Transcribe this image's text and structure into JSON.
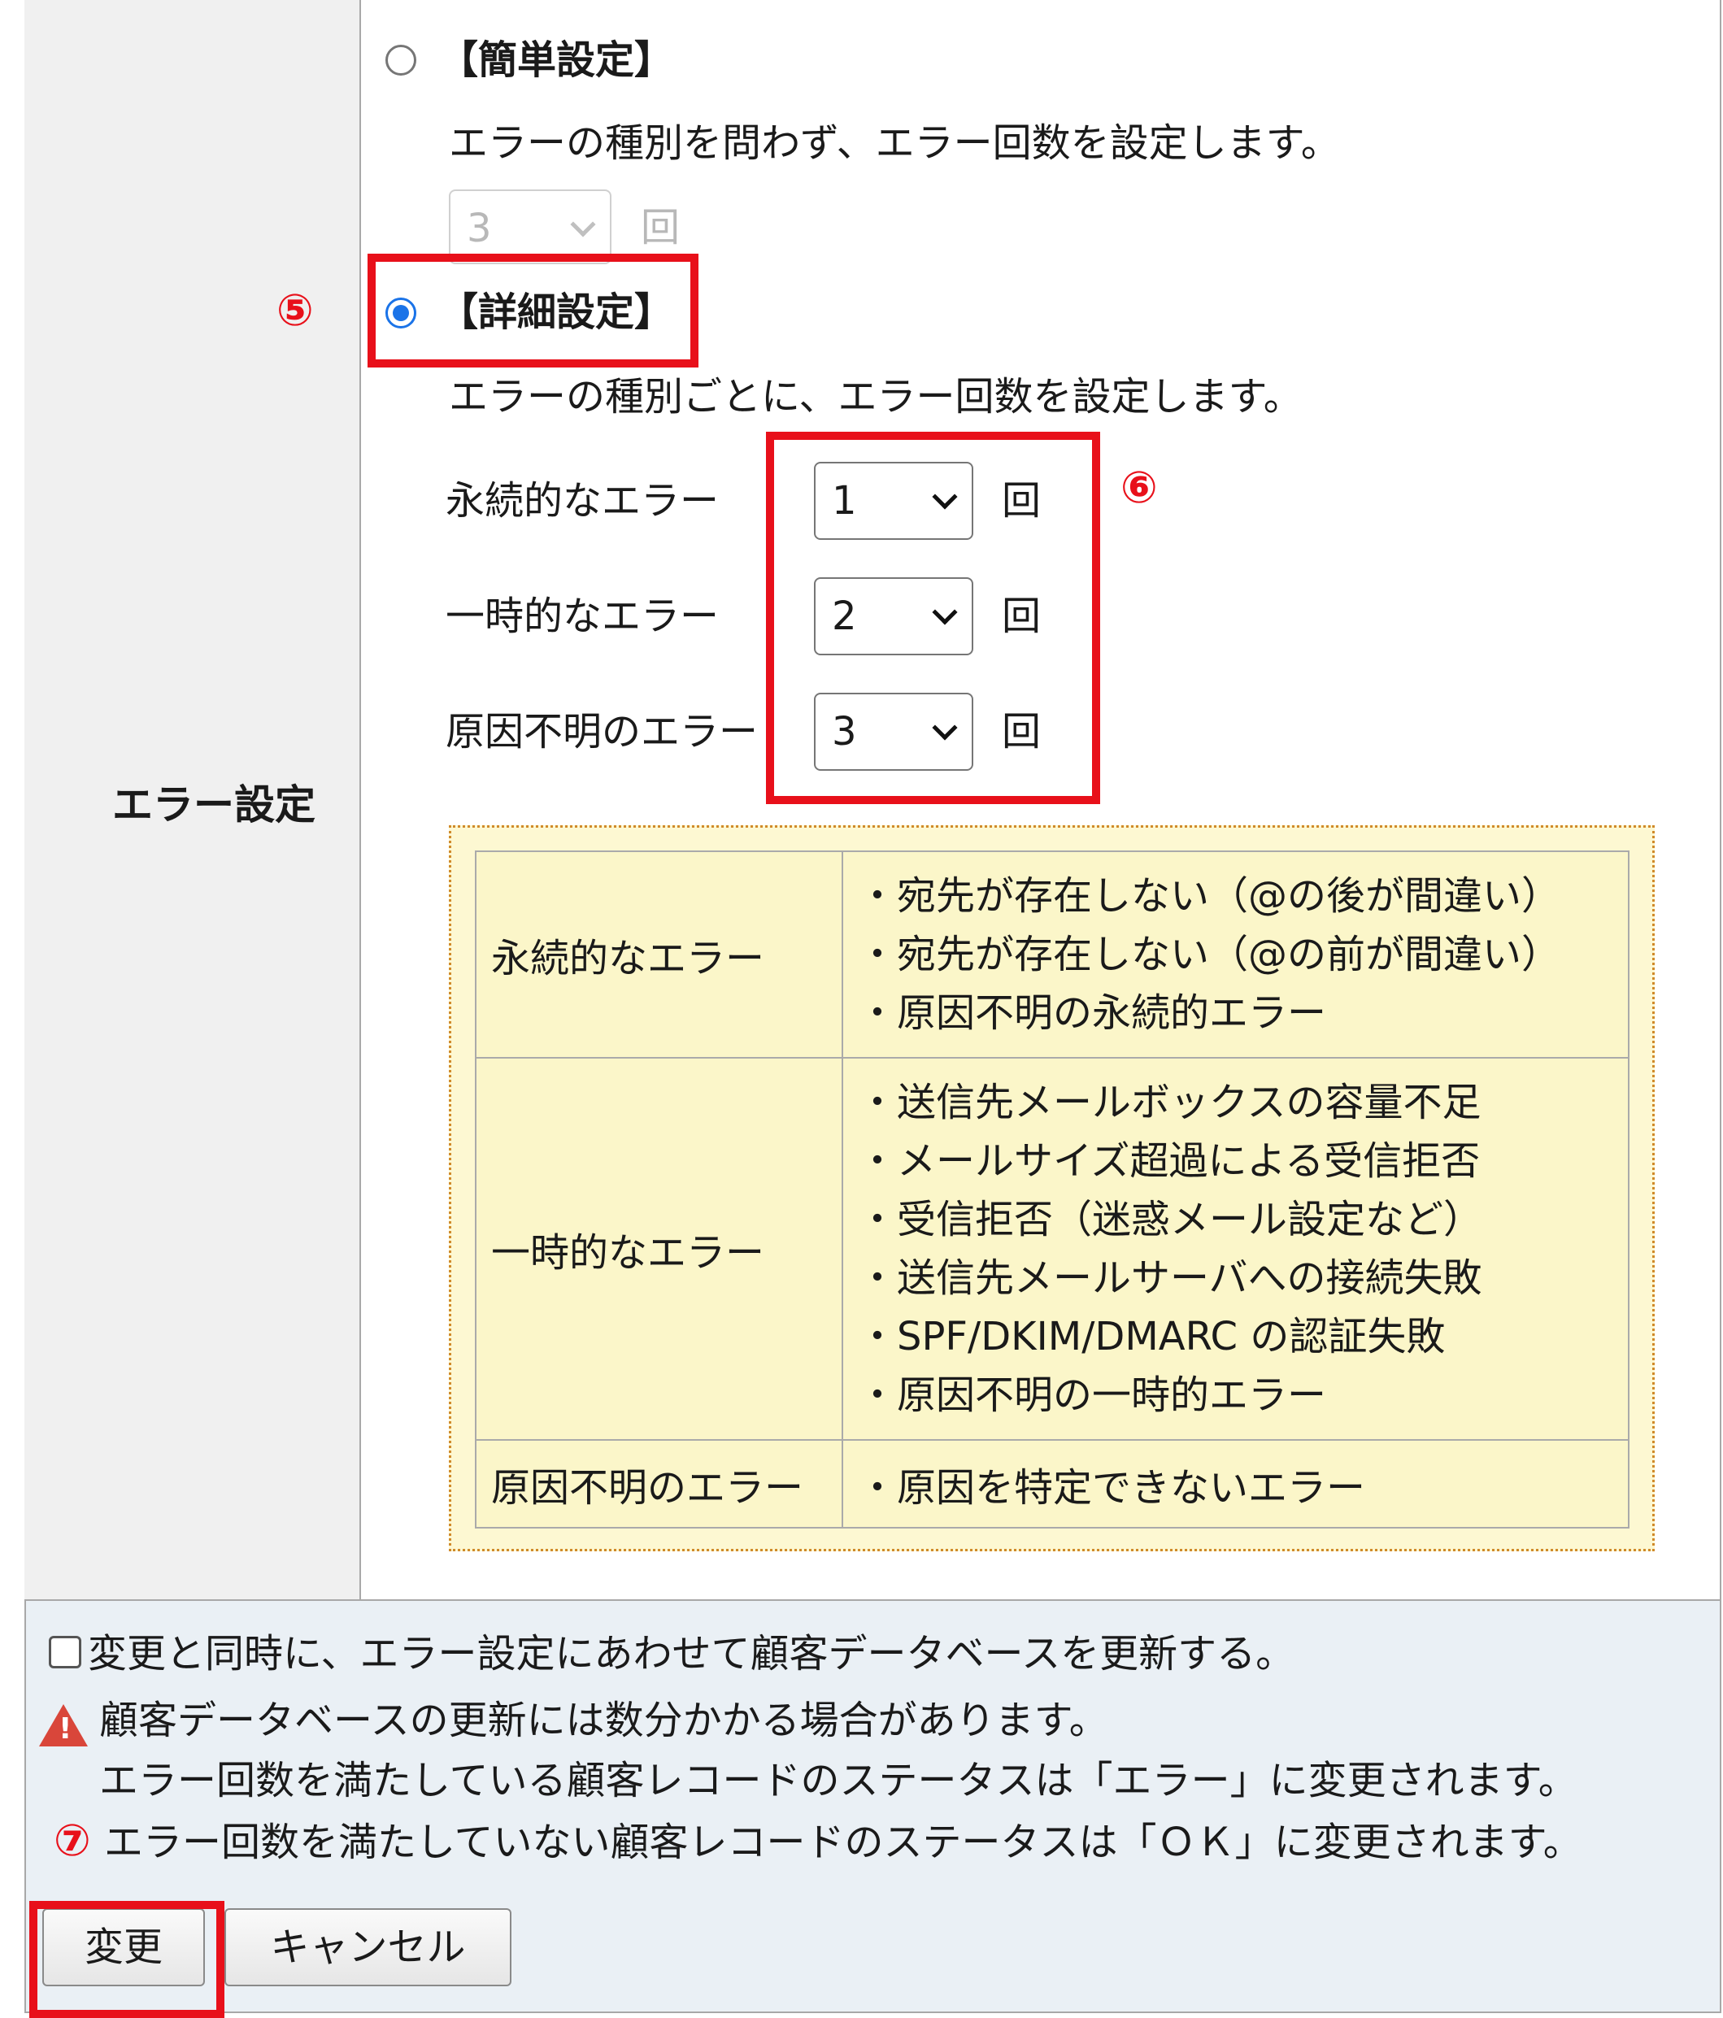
{
  "section_label": "エラー設定",
  "simple": {
    "title": "【簡単設定】",
    "description": "エラーの種別を問わず、エラー回数を設定します。",
    "count_value": "3",
    "unit": "回"
  },
  "detail": {
    "title": "【詳細設定】",
    "description": "エラーの種別ごとに、エラー回数を設定します。",
    "rows": [
      {
        "label": "永続的なエラー",
        "value": "1",
        "unit": "回"
      },
      {
        "label": "一時的なエラー",
        "value": "2",
        "unit": "回"
      },
      {
        "label": "原因不明のエラー",
        "value": "3",
        "unit": "回"
      }
    ]
  },
  "annotations": {
    "five": "⑤",
    "six": "⑥",
    "seven": "⑦"
  },
  "error_table": [
    {
      "type": "永続的なエラー",
      "items": [
        "・宛先が存在しない（@の後が間違い）",
        "・宛先が存在しない（@の前が間違い）",
        "・原因不明の永続的エラー"
      ]
    },
    {
      "type": "一時的なエラー",
      "items": [
        "・送信先メールボックスの容量不足",
        "・メールサイズ超過による受信拒否",
        "・受信拒否（迷惑メール設定など）",
        "・送信先メールサーバへの接続失敗",
        "・SPF/DKIM/DMARC の認証失敗",
        "・原因不明の一時的エラー"
      ]
    },
    {
      "type": "原因不明のエラー",
      "items": [
        "・原因を特定できないエラー"
      ]
    }
  ],
  "update_checkbox_label": "変更と同時に、エラー設定にあわせて顧客データベースを更新する。",
  "warning": {
    "line1": "顧客データベースの更新には数分かかる場合があります。",
    "line2": "エラー回数を満たしている顧客レコードのステータスは「エラー」に変更されます。",
    "line3": "エラー回数を満たしていない顧客レコードのステータスは「ＯＫ」に変更されます。"
  },
  "buttons": {
    "change": "変更",
    "cancel": "キャンセル"
  }
}
